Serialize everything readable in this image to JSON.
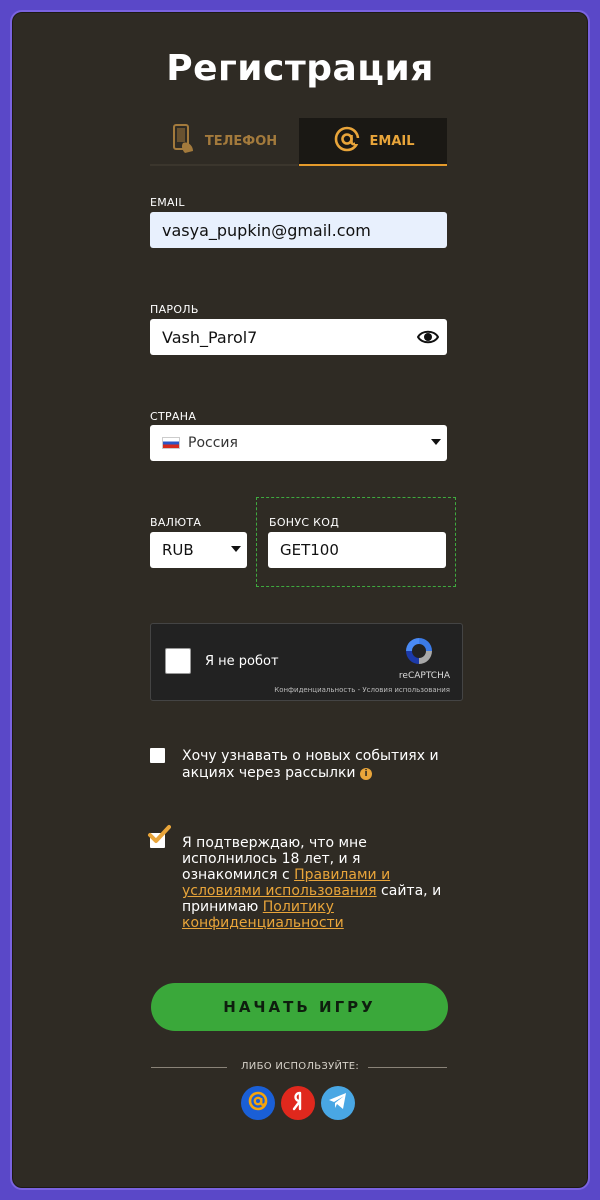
{
  "title": "Регистрация",
  "tabs": [
    {
      "label": "ТЕЛЕФОН",
      "active": false
    },
    {
      "label": "EMAIL",
      "active": true
    }
  ],
  "form": {
    "email_label": "EMAIL",
    "email_value": "vasya_pupkin@gmail.com",
    "password_label": "ПАРОЛЬ",
    "password_value": "Vash_Parol7",
    "country_label": "СТРАНА",
    "country_value": "Россия",
    "currency_label": "ВАЛЮТА",
    "currency_value": "RUB",
    "bonus_label": "БОНУС КОД",
    "bonus_value": "GET100"
  },
  "captcha": {
    "text": "Я не робот",
    "brand": "reCAPTCHA",
    "links": "Конфиденциальность - Условия использования"
  },
  "newsletter": {
    "text": "Хочу узнавать о новых событиях и акциях через рассылки",
    "checked": false
  },
  "agree": {
    "part1": "Я подтверждаю, что мне исполнилось 18 лет, и я ознакомился с ",
    "link1": "Правилами и условиями использования",
    "part2": " сайта, и принимаю ",
    "link2": "Политику конфиденциальности",
    "checked": true
  },
  "start_button": "НАЧАТЬ ИГРУ",
  "or_text": "ЛИБО ИСПОЛЬЗУЙТЕ:",
  "social": [
    {
      "name": "mail-ru-icon",
      "glyph": "@",
      "color": "#1a5fd6"
    },
    {
      "name": "yandex-icon",
      "glyph": "Я",
      "color": "#e0281d"
    },
    {
      "name": "telegram-icon",
      "glyph": "",
      "color": "#49a7e4"
    }
  ],
  "colors": {
    "background": "#2f2b24",
    "accent": "#e9a53a",
    "button": "#3aa83a",
    "frame": "#7a63e0"
  }
}
